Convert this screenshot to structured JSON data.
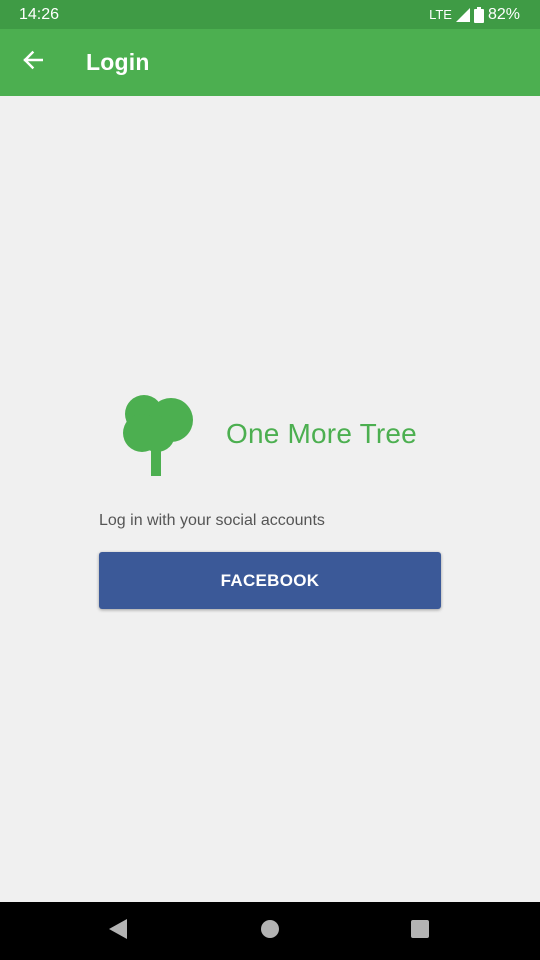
{
  "status_bar": {
    "time": "14:26",
    "network": "LTE",
    "battery": "82%",
    "icons": [
      "signal-icon",
      "battery-icon"
    ]
  },
  "app_bar": {
    "title": "Login",
    "back_icon": "arrow-back-icon"
  },
  "logo": {
    "app_name": "One More Tree",
    "icon": "tree-logo-icon"
  },
  "login": {
    "prompt": "Log in with your social accounts",
    "facebook_label": "FACEBOOK"
  },
  "nav_bar": {
    "icons": [
      "back-triangle-icon",
      "home-circle-icon",
      "recents-square-icon"
    ]
  },
  "colors": {
    "status_bar": "#3f9b45",
    "app_bar": "#4caf50",
    "brand_green": "#4caf50",
    "facebook_blue": "#3b5998",
    "background": "#f0f0f0"
  }
}
